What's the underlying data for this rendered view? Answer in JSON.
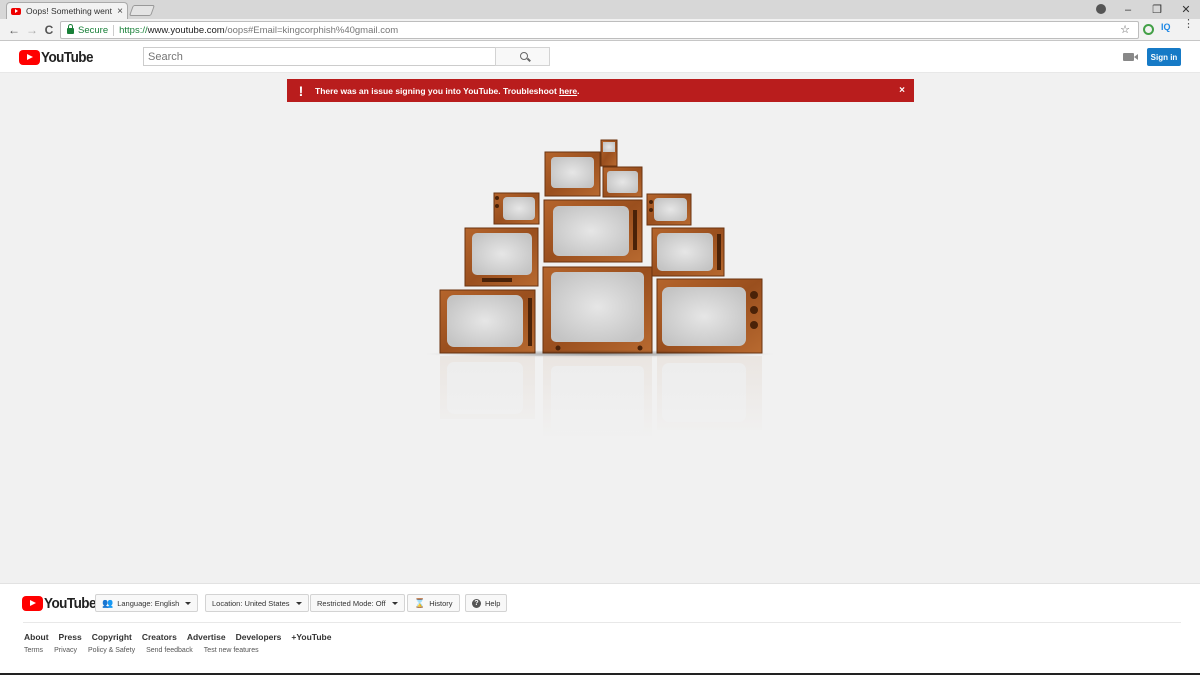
{
  "browser": {
    "tab_title": "Oops! Something went w",
    "tab_close": "×",
    "secure_label": "Secure",
    "url_scheme": "https://",
    "url_host": "www.youtube.com",
    "url_path": "/oops#Email=kingcorphish%40gmail.com",
    "ext_label": "IQ",
    "star": "☆",
    "back": "←",
    "forward": "→",
    "reload": "C",
    "minimize": "–",
    "restore": "❐",
    "close": "✕",
    "menu": "⋮"
  },
  "masthead": {
    "logo_text": "YouTube",
    "search_placeholder": "Search",
    "signin_label": "Sign in"
  },
  "alert": {
    "icon": "!",
    "text_before": "There was an issue signing you into YouTube. Troubleshoot ",
    "link_text": "here",
    "text_after": ".",
    "close": "×",
    "color": "#b91d1d"
  },
  "footer": {
    "logo_text": "YouTube",
    "language_label": "Language: English",
    "location_label": "Location: United States",
    "restricted_label": "Restricted Mode: Off",
    "history_label": "History",
    "help_label": "Help",
    "links": [
      "About",
      "Press",
      "Copyright",
      "Creators",
      "Advertise",
      "Developers",
      "+YouTube"
    ],
    "small_links": [
      "Terms",
      "Privacy",
      "Policy & Safety",
      "Send feedback",
      "Test new features"
    ]
  }
}
